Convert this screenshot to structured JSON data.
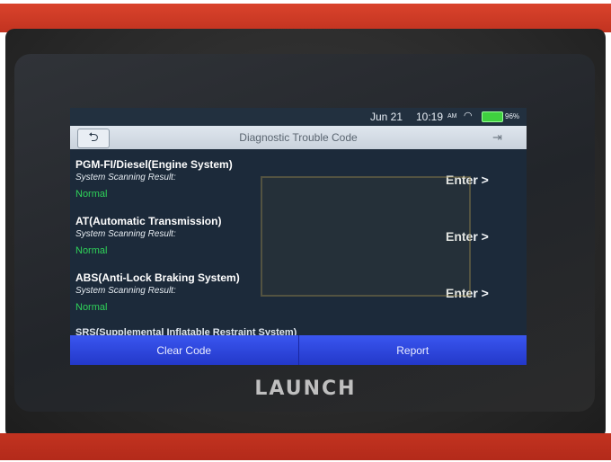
{
  "status": {
    "date": "Jun 21",
    "time": "10:19",
    "ampm": "AM",
    "battery": "96%",
    "wifi_icon": "wifi-icon",
    "battery_icon": "battery-icon"
  },
  "titlebar": {
    "title": "Diagnostic Trouble Code",
    "back_icon": "back-arrow-icon",
    "exit_icon": "exit-icon"
  },
  "systems": [
    {
      "name": "PGM-FI/Diesel(Engine System)",
      "scan_label": "System Scanning Result:",
      "result": "Normal",
      "enter": "Enter >"
    },
    {
      "name": "AT(Automatic Transmission)",
      "scan_label": "System Scanning Result:",
      "result": "Normal",
      "enter": "Enter >"
    },
    {
      "name": "ABS(Anti-Lock Braking System)",
      "scan_label": "System Scanning Result:",
      "result": "Normal",
      "enter": "Enter >"
    }
  ],
  "partial_item": "SRS(Supplemental Inflatable Restraint System)",
  "buttons": {
    "clear": "Clear Code",
    "report": "Report"
  },
  "brand": "LAUNCH",
  "colors": {
    "accent": "#2a43d8",
    "normal": "#2fd35a",
    "device_red": "#c93a26"
  }
}
